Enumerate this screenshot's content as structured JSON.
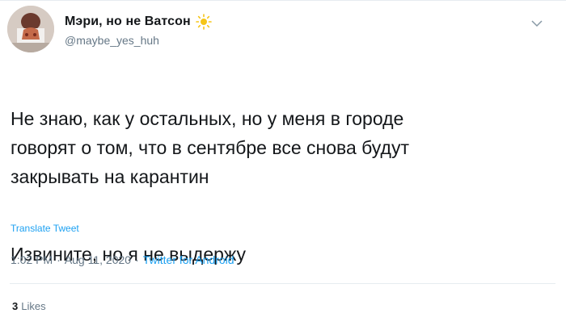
{
  "author": {
    "display_name": "Мэри, но не Ватсон",
    "emoji_icon": "sun-icon",
    "handle": "@maybe_yes_huh"
  },
  "tweet": {
    "paragraph1": "Не знаю, как у остальных, но у меня в городе\nговорят о том, что в сентябре все снова будут\nзакрывать на карантин",
    "paragraph2": "Извините, но я не выдержу",
    "translate_label": "Translate Tweet"
  },
  "meta": {
    "time": "1:02 PM",
    "separator": "·",
    "date": "Aug 11, 2020",
    "separator2": "·",
    "source": "Twitter for Android"
  },
  "stats": {
    "likes_count": "3",
    "likes_label": "Likes"
  },
  "colors": {
    "link": "#1da1f2",
    "secondary": "#657786",
    "text": "#14171a"
  }
}
